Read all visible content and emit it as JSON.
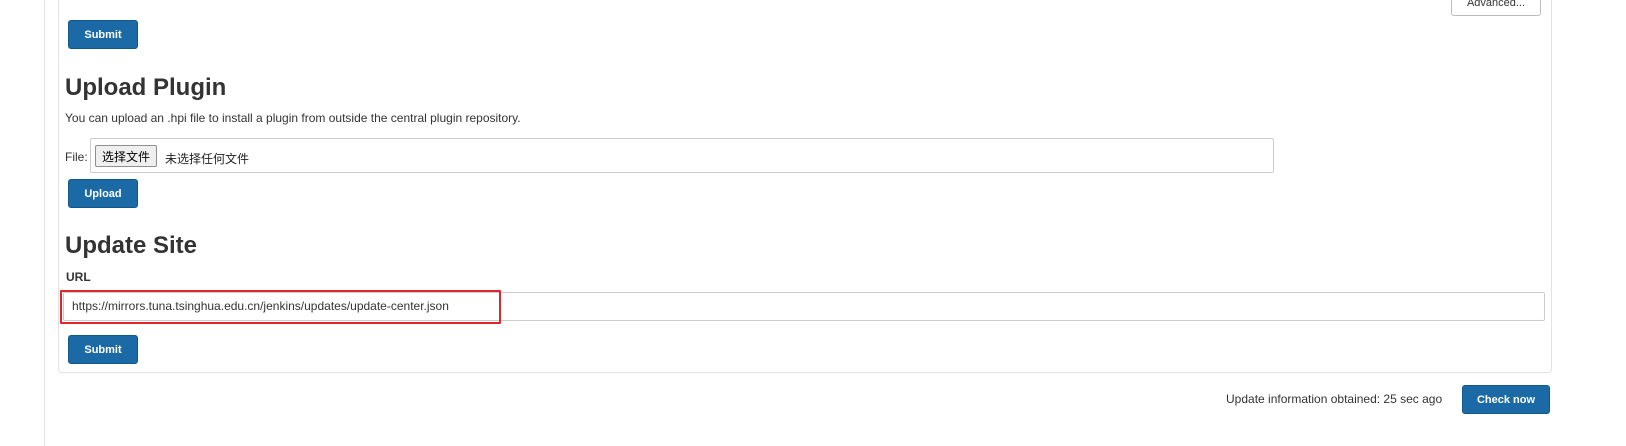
{
  "advanced_button": {
    "label": "Advanced..."
  },
  "proxy_section": {
    "submit_label": "Submit"
  },
  "upload_plugin": {
    "title": "Upload Plugin",
    "description": "You can upload an .hpi file to install a plugin from outside the central plugin repository.",
    "file_label": "File:",
    "choose_file_label": "选择文件",
    "no_file_text": "未选择任何文件",
    "upload_label": "Upload"
  },
  "update_site": {
    "title": "Update Site",
    "url_label": "URL",
    "url_value": "https://mirrors.tuna.tsinghua.edu.cn/jenkins/updates/update-center.json",
    "submit_label": "Submit"
  },
  "footer": {
    "update_info": "Update information obtained: 25 sec ago",
    "check_now_label": "Check now"
  },
  "colors": {
    "primary_button": "#1b6aa5",
    "highlight_border": "#e0262a"
  }
}
